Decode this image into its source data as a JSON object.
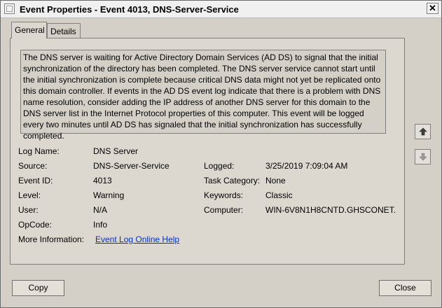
{
  "window": {
    "title": "Event Properties - Event 4013, DNS-Server-Service",
    "close_glyph": "✕"
  },
  "tabs": [
    {
      "label": "General"
    },
    {
      "label": "Details"
    }
  ],
  "description": "The DNS server is waiting for Active Directory Domain Services (AD DS) to signal that the initial synchronization of the directory has been completed. The DNS server service cannot start until the initial synchronization is complete because critical DNS data might not yet be replicated onto this domain controller. If events in the AD DS event log indicate that there is a problem with DNS name resolution, consider adding the IP address of another DNS server for this domain to the DNS server list in the Internet Protocol properties of this computer. This event will be logged every two minutes until AD DS has signaled that the initial synchronization has successfully completed.",
  "fields": {
    "log_name": {
      "label": "Log Name:",
      "value": "DNS Server"
    },
    "source": {
      "label": "Source:",
      "value": "DNS-Server-Service"
    },
    "logged": {
      "label": "Logged:",
      "value": "3/25/2019 7:09:04 AM"
    },
    "event_id": {
      "label": "Event ID:",
      "value": "4013"
    },
    "task_category": {
      "label": "Task Category:",
      "value": "None"
    },
    "level": {
      "label": "Level:",
      "value": "Warning"
    },
    "keywords": {
      "label": "Keywords:",
      "value": "Classic"
    },
    "user": {
      "label": "User:",
      "value": "N/A"
    },
    "computer": {
      "label": "Computer:",
      "value": "WIN-6V8N1H8CNTD.GHSCONET."
    },
    "opcode": {
      "label": "OpCode:",
      "value": "Info"
    },
    "more_info": {
      "label": "More Information:",
      "value": "Event Log Online Help"
    }
  },
  "nav": {
    "up_icon": "arrow-up-icon",
    "down_icon": "arrow-down-icon"
  },
  "buttons": {
    "copy": "Copy",
    "close": "Close"
  }
}
